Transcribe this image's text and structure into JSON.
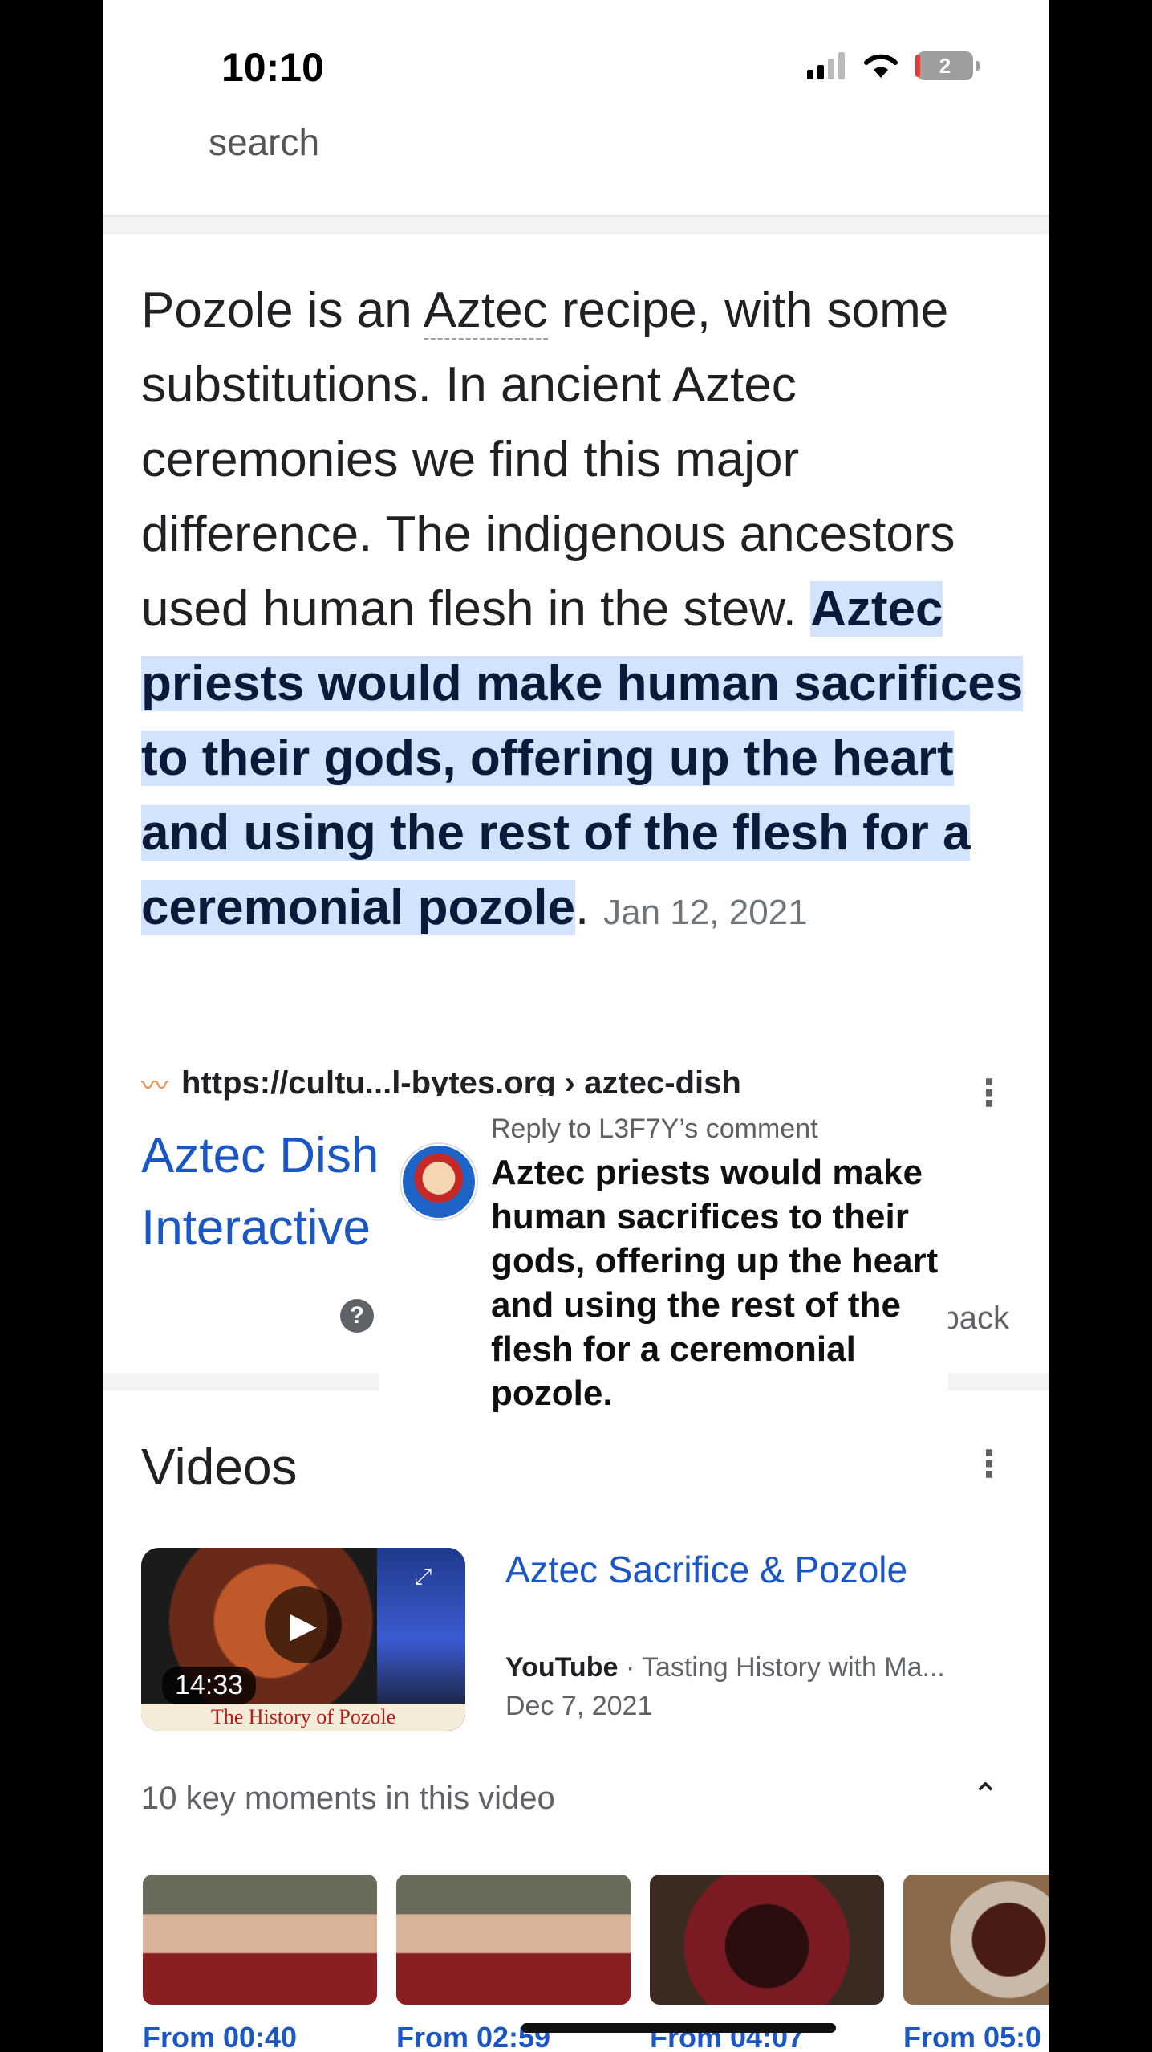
{
  "status_bar": {
    "time": "10:10",
    "battery": "2"
  },
  "search_remnant": "search",
  "snippet": {
    "before_link": "Pozole is an ",
    "link": "Aztec",
    "after_link": " recipe, with some substitutions. In ancient Aztec ceremonies we find this major difference. The indigenous ancestors used human flesh in the stew. ",
    "highlight": "Aztec priests would make human sacrifices to their gods, offering up the heart and using the rest of the flesh for a ceremonial pozole",
    "end": ".",
    "date": "Jan 12, 2021"
  },
  "source": {
    "url": "https://cultu...l-bytes.org › aztec-dish",
    "title": "Aztec Dish Interactive"
  },
  "feedback": "back",
  "reply_card": {
    "label": "Reply to L3F7Y’s comment",
    "text": "Aztec priests would make human sacrifices to their gods, offering up the heart and using the rest of the flesh for a ceremonial pozole."
  },
  "videos": {
    "title": "Videos",
    "items": [
      {
        "title": "Aztec Sacrifice & Pozole",
        "source": "YouTube",
        "channel": " · Tasting History with Ma...",
        "date": "Dec 7, 2021",
        "duration": "14:33",
        "thumb_caption": "The History of Pozole"
      }
    ],
    "key_moments": "10 key moments in this video",
    "moments": [
      {
        "label": "From 00:40"
      },
      {
        "label": "From 02:59"
      },
      {
        "label": "From 04:07"
      },
      {
        "label": "From 05:0"
      }
    ]
  }
}
